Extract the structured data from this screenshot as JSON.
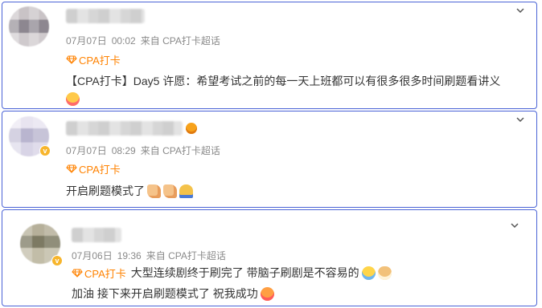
{
  "posts": [
    {
      "date": "07月07日",
      "time": "00:02",
      "source": "来自 CPA打卡超话",
      "supertopic": "CPA打卡",
      "content_lines": [
        "【CPA打卡】Day5 许愿：希望考试之前的每一天上班都可以有很多很多时间刷题看讲义"
      ],
      "emojis_line2": [
        "kiss-face"
      ]
    },
    {
      "date": "07月07日",
      "time": "08:29",
      "source": "来自 CPA打卡超话",
      "supertopic": "CPA打卡",
      "content_lines": [
        "开启刷题模式了"
      ],
      "emojis": [
        "flexed-biceps",
        "flexed-biceps",
        "folded-hands"
      ]
    },
    {
      "date": "07月06日",
      "time": "19:36",
      "source": "来自 CPA打卡超话",
      "supertopic": "CPA打卡",
      "content_inline": "大型连续剧终于刷完了 带脑子刷剧是不容易的",
      "content_line2": "加油 接下来开启刷题模式了 祝我成功",
      "emojis_inline": [
        "crying-face",
        "doge"
      ],
      "emojis_line2": [
        "cheering-face"
      ]
    }
  ],
  "colors": {
    "accent": "#ff8200",
    "border": "#4a63d6",
    "meta": "#8a8a8a",
    "text": "#333333"
  },
  "icons": {
    "supertopic": "diamond-gem-icon",
    "menu": "chevron-down-icon",
    "verified": "verified-badge-icon"
  }
}
